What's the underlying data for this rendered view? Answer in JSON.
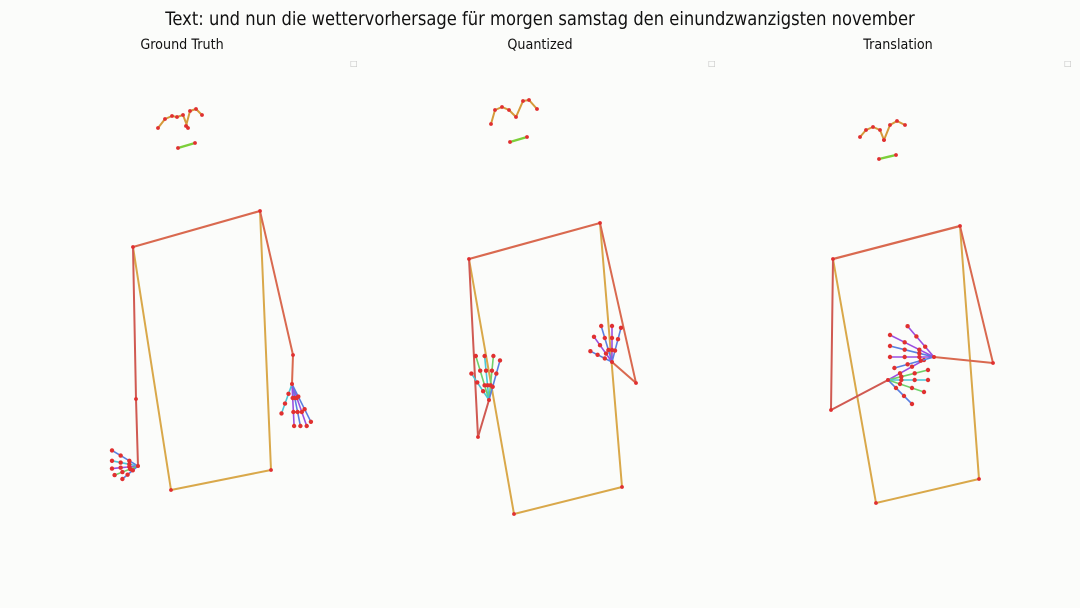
{
  "figure": {
    "title": "Text: und nun die wettervorhersage für morgen samstag den einundzwanzigsten november",
    "panels": [
      {
        "title": "Ground Truth",
        "marker": "□"
      },
      {
        "title": "Quantized",
        "marker": "□"
      },
      {
        "title": "Translation",
        "marker": "□"
      }
    ]
  },
  "colors": {
    "shoulder_line": "#d9694f",
    "torso_line": "#d9a84a",
    "arm_left": "#d05a52",
    "joint": "#e03030",
    "face_green": "#7ccf3a",
    "face_orange": "#d59a3a",
    "hand_blue": "#5a7fe0",
    "hand_cyan": "#49c7d8",
    "hand_purple": "#9b4fe0",
    "hand_green": "#6fd06a"
  }
}
